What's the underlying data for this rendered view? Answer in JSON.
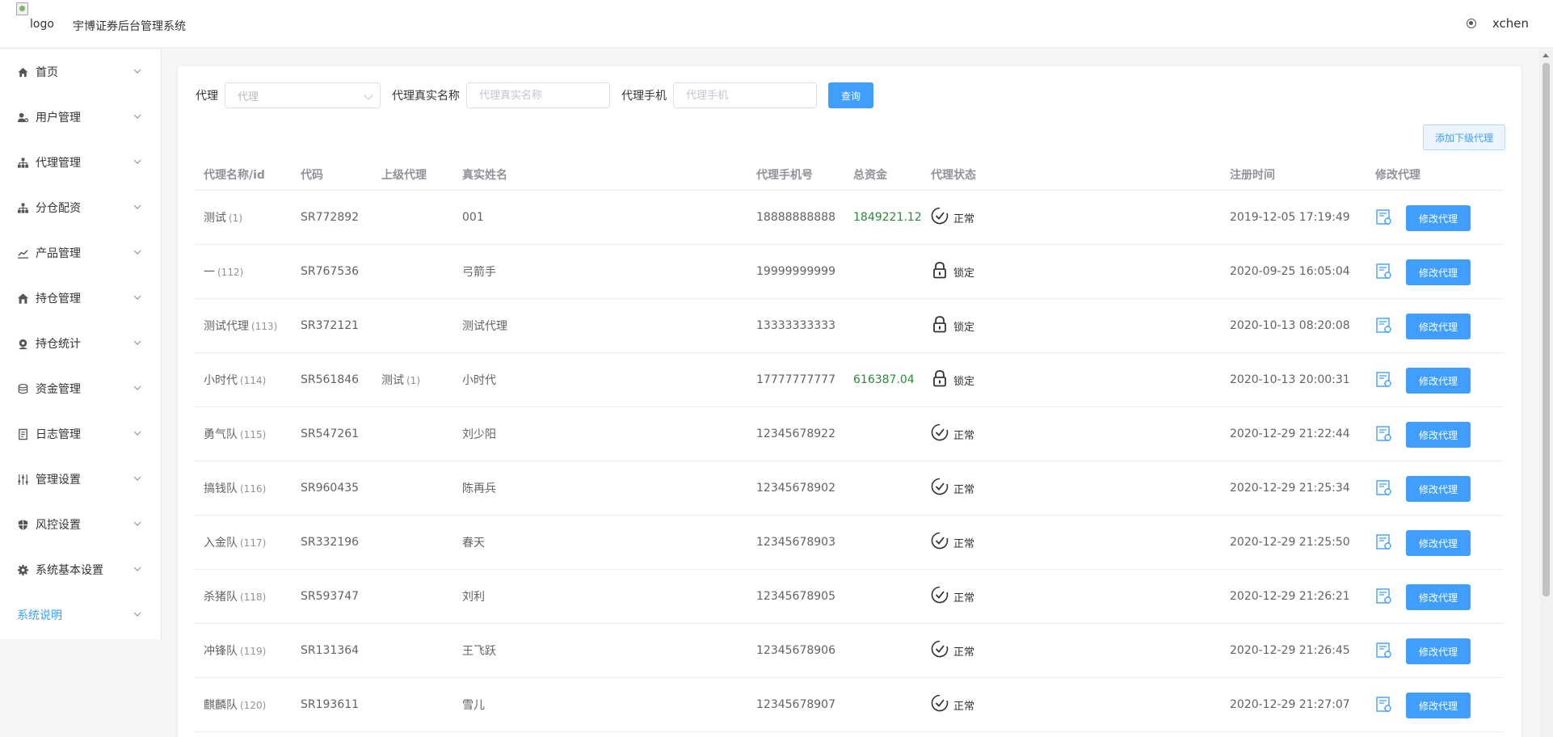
{
  "header": {
    "logo_alt": "logo",
    "system_title": "宇博证券后台管理系统",
    "user_name": "xchen"
  },
  "sidebar": {
    "items": [
      {
        "label": "首页",
        "icon": "home-icon"
      },
      {
        "label": "用户管理",
        "icon": "user-icon"
      },
      {
        "label": "代理管理",
        "icon": "org-icon"
      },
      {
        "label": "分仓配资",
        "icon": "org-icon"
      },
      {
        "label": "产品管理",
        "icon": "chart-icon"
      },
      {
        "label": "持仓管理",
        "icon": "house-icon"
      },
      {
        "label": "持仓统计",
        "icon": "gear-user-icon"
      },
      {
        "label": "资金管理",
        "icon": "coin-icon"
      },
      {
        "label": "日志管理",
        "icon": "doc-icon"
      },
      {
        "label": "管理设置",
        "icon": "sliders-icon"
      },
      {
        "label": "风控设置",
        "icon": "shield-icon"
      },
      {
        "label": "系统基本设置",
        "icon": "gear-icon"
      },
      {
        "label": "系统说明",
        "icon": ""
      }
    ]
  },
  "filters": {
    "agent_label": "代理",
    "agent_placeholder": "代理",
    "realname_label": "代理真实名称",
    "realname_placeholder": "代理真实名称",
    "phone_label": "代理手机",
    "phone_placeholder": "代理手机",
    "query_button": "查询"
  },
  "add_button": "添加下级代理",
  "table": {
    "headers": {
      "name": "代理名称/id",
      "code": "代码",
      "parent": "上级代理",
      "real_name": "真实姓名",
      "phone": "代理手机号",
      "funds": "总资金",
      "status": "代理状态",
      "reg_time": "注册时间",
      "edit": "修改代理"
    },
    "edit_button_label": "修改代理",
    "rows": [
      {
        "name": "测试",
        "id": "(1)",
        "code": "SR772892",
        "parent": "",
        "parent_id": "",
        "real_name": "001",
        "phone": "18888888888",
        "funds": "1849221.12",
        "status": "正常",
        "status_type": "normal",
        "reg_time": "2019-12-05 17:19:49"
      },
      {
        "name": "一",
        "id": "(112)",
        "code": "SR767536",
        "parent": "",
        "parent_id": "",
        "real_name": "弓箭手",
        "phone": "19999999999",
        "funds": "",
        "status": "锁定",
        "status_type": "locked",
        "reg_time": "2020-09-25 16:05:04"
      },
      {
        "name": "测试代理",
        "id": "(113)",
        "code": "SR372121",
        "parent": "",
        "parent_id": "",
        "real_name": "测试代理",
        "phone": "13333333333",
        "funds": "",
        "status": "锁定",
        "status_type": "locked",
        "reg_time": "2020-10-13 08:20:08"
      },
      {
        "name": "小时代",
        "id": "(114)",
        "code": "SR561846",
        "parent": "测试",
        "parent_id": "(1)",
        "real_name": "小时代",
        "phone": "17777777777",
        "funds": "616387.04",
        "status": "锁定",
        "status_type": "locked",
        "reg_time": "2020-10-13 20:00:31"
      },
      {
        "name": "勇气队",
        "id": "(115)",
        "code": "SR547261",
        "parent": "",
        "parent_id": "",
        "real_name": "刘少阳",
        "phone": "12345678922",
        "funds": "",
        "status": "正常",
        "status_type": "normal",
        "reg_time": "2020-12-29 21:22:44"
      },
      {
        "name": "搞钱队",
        "id": "(116)",
        "code": "SR960435",
        "parent": "",
        "parent_id": "",
        "real_name": "陈再兵",
        "phone": "12345678902",
        "funds": "",
        "status": "正常",
        "status_type": "normal",
        "reg_time": "2020-12-29 21:25:34"
      },
      {
        "name": "入金队",
        "id": "(117)",
        "code": "SR332196",
        "parent": "",
        "parent_id": "",
        "real_name": "春天",
        "phone": "12345678903",
        "funds": "",
        "status": "正常",
        "status_type": "normal",
        "reg_time": "2020-12-29 21:25:50"
      },
      {
        "name": "杀猪队",
        "id": "(118)",
        "code": "SR593747",
        "parent": "",
        "parent_id": "",
        "real_name": "刘利",
        "phone": "12345678905",
        "funds": "",
        "status": "正常",
        "status_type": "normal",
        "reg_time": "2020-12-29 21:26:21"
      },
      {
        "name": "冲锋队",
        "id": "(119)",
        "code": "SR131364",
        "parent": "",
        "parent_id": "",
        "real_name": "王飞跃",
        "phone": "12345678906",
        "funds": "",
        "status": "正常",
        "status_type": "normal",
        "reg_time": "2020-12-29 21:26:45"
      },
      {
        "name": "麒麟队",
        "id": "(120)",
        "code": "SR193611",
        "parent": "",
        "parent_id": "",
        "real_name": "雪儿",
        "phone": "12345678907",
        "funds": "",
        "status": "正常",
        "status_type": "normal",
        "reg_time": "2020-12-29 21:27:07"
      }
    ]
  },
  "colors": {
    "primary": "#409eff",
    "money_green": "#2a8a3a"
  }
}
